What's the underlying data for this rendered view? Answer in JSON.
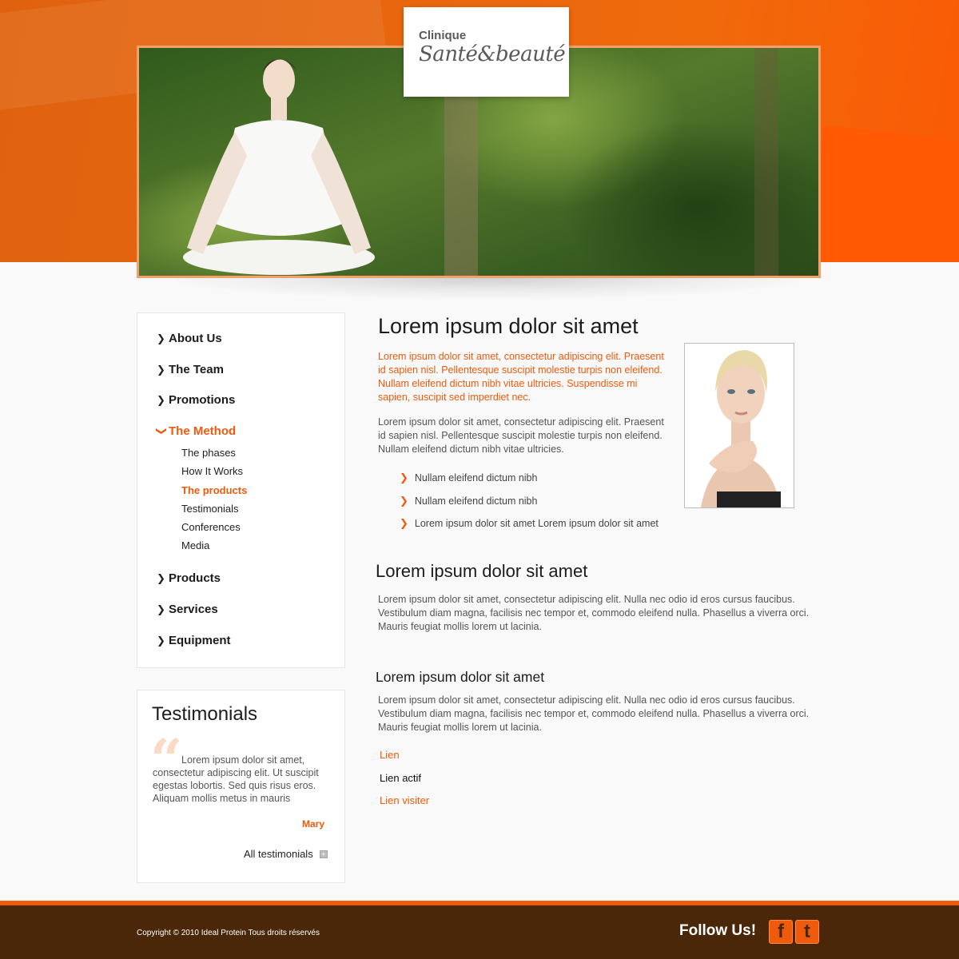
{
  "brand": {
    "line1": "Clinique",
    "line2": "Santé&beauté"
  },
  "colors": {
    "accent": "#ef5a0c",
    "header": "#e8670e",
    "footer": "#4a2708"
  },
  "nav": {
    "items": [
      {
        "label": "About Us",
        "icon": "chevron-right-icon"
      },
      {
        "label": "The Team",
        "icon": "chevron-right-icon"
      },
      {
        "label": "Promotions",
        "icon": "chevron-right-icon"
      },
      {
        "label": "The Method",
        "icon": "chevron-down-icon",
        "active": true
      },
      {
        "label": "Products",
        "icon": "chevron-right-icon"
      },
      {
        "label": "Services",
        "icon": "chevron-right-icon"
      },
      {
        "label": "Equipment",
        "icon": "chevron-right-icon"
      }
    ],
    "subitems": [
      {
        "label": "The phases"
      },
      {
        "label": "How It Works"
      },
      {
        "label": "The products",
        "active": true
      },
      {
        "label": "Testimonials"
      },
      {
        "label": "Conferences"
      },
      {
        "label": "Media"
      }
    ]
  },
  "testimonials": {
    "title": "Testimonials",
    "quote": "Lorem ipsum dolor sit amet, consectetur adipiscing elit. Ut suscipit egestas lobortis. Sed quis risus eros. Aliquam mollis metus in mauris",
    "author": "Mary",
    "all_label": "All testimonials"
  },
  "main": {
    "title": "Lorem ipsum dolor sit amet",
    "lead": "Lorem ipsum dolor sit amet, consectetur adipiscing elit. Praesent id sapien nisl. Pellentesque suscipit molestie turpis non eleifend. Nullam eleifend dictum nibh vitae ultricies. Suspendisse mi sapien, suscipit sed imperdiet nec.",
    "para1": "Lorem ipsum dolor sit amet, consectetur adipiscing elit. Praesent id sapien nisl. Pellentesque suscipit molestie turpis non eleifend. Nullam eleifend dictum nibh vitae ultricies.",
    "bullets": [
      "Nullam eleifend dictum nibh",
      "Nullam eleifend dictum nibh",
      "Lorem ipsum dolor sit amet Lorem ipsum dolor sit amet"
    ],
    "section2_title": "Lorem ipsum dolor sit amet",
    "section2_text": "Lorem ipsum dolor sit amet, consectetur adipiscing elit. Nulla nec odio id eros cursus faucibus. Vestibulum diam magna, facilisis nec tempor et, commodo eleifend nulla. Phasellus a viverra orci. Mauris feugiat mollis lorem ut lacinia.",
    "section3_title": "Lorem ipsum dolor sit amet",
    "section3_text": "Lorem ipsum dolor sit amet, consectetur adipiscing elit. Nulla nec odio id eros cursus faucibus. Vestibulum diam magna, facilisis nec tempor et, commodo eleifend nulla. Phasellus a viverra orci. Mauris feugiat mollis lorem ut lacinia.",
    "links": {
      "normal": "Lien",
      "active": "Lien actif",
      "visited": "Lien visiter"
    }
  },
  "footer": {
    "copyright": "Copyright © 2010 Ideal Protein Tous droits réservés",
    "follow": "Follow Us!",
    "facebook_glyph": "f",
    "twitter_glyph": "t",
    "facebook_icon": "facebook-icon",
    "twitter_icon": "twitter-icon"
  }
}
